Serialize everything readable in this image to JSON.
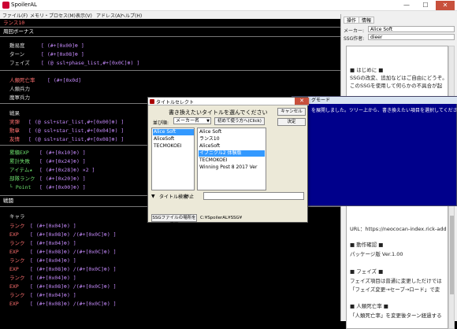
{
  "window": {
    "title": "SpoilerAL",
    "close": "✕",
    "minimize": "—",
    "maximize": "☐"
  },
  "menu": [
    "ファイル(F)",
    "メモリ・プロセス(M)",
    "表示(V)",
    "アドレス(A)",
    "ヘルプ(H)"
  ],
  "left": {
    "title": "ランス10",
    "rows": [
      {
        "kind": "head",
        "text": "周回ボーナス"
      },
      {
        "kind": "row",
        "label": "難易度",
        "code": "[ (#+[0x00]⊕ ]"
      },
      {
        "kind": "row",
        "label": "ターン",
        "code": "[ (#+[0x08]⊕ ]"
      },
      {
        "kind": "row",
        "label": "フェイズ",
        "code": "[ (@ ssl+phase_list,#+[0x0C]⊕) ]"
      },
      {
        "kind": "row",
        "label": "人類死亡率",
        "code": "[ (#+[0x0d]"
      },
      {
        "kind": "plain",
        "label": "人類兵力"
      },
      {
        "kind": "plain",
        "label": "魔軍兵力"
      },
      {
        "kind": "row",
        "label": "戦果",
        "code": ""
      },
      {
        "kind": "row",
        "label": "実弾",
        "code": "[ (@ ssl+star_list,#+[0x00]⊕) ]"
      },
      {
        "kind": "row",
        "label": "勲章",
        "code": "[ (@ ssl+star_list,#+[0x04]⊕) ]"
      },
      {
        "kind": "row",
        "label": "友情",
        "code": "[ (@ ssl+star_list,#+[0x08]⊕) ]"
      },
      {
        "kind": "row",
        "label": "累積EXP",
        "code": "[ (#+[0x10]⊕) ]"
      },
      {
        "kind": "row",
        "label": "累計失敗",
        "code": "[ (#+[0x24]⊕) ]"
      },
      {
        "kind": "row",
        "label": "アイテム★",
        "code": "[ (#+[0x28]⊕) ×2 ]"
      },
      {
        "kind": "row",
        "label": "部隊ランク",
        "code": "[ (#+[0x20]⊕) ]"
      },
      {
        "kind": "row",
        "label": "└ Point",
        "code": "[ (#+[0x00]⊕) ]"
      },
      {
        "kind": "head",
        "text": "戦闘"
      },
      {
        "kind": "plain",
        "label": "キャラ"
      },
      {
        "kind": "row",
        "label": "ランク",
        "code": "[ (#+[0x04]⊕) ]"
      },
      {
        "kind": "row",
        "label": "EXP",
        "code": "[ (#+[0x08]⊕) /(#+[0x0C]⊕) ]"
      },
      {
        "kind": "row",
        "label": "ランク",
        "code": "[ (#+[0x04]⊕) ]"
      },
      {
        "kind": "row",
        "label": "EXP",
        "code": "[ (#+[0x08]⊕) /(#+[0x0C]⊕) ]"
      },
      {
        "kind": "row",
        "label": "ランク",
        "code": "[ (#+[0x04]⊕) ]"
      },
      {
        "kind": "row",
        "label": "EXP",
        "code": "[ (#+[0x08]⊕) /(#+[0x0C]⊕) ]"
      },
      {
        "kind": "row",
        "label": "ランク",
        "code": "[ (#+[0x04]⊕) ]"
      },
      {
        "kind": "row",
        "label": "EXP",
        "code": "[ (#+[0x08]⊕) /(#+[0x0C]⊕) ]"
      },
      {
        "kind": "row",
        "label": "ランク",
        "code": "[ (#+[0x04]⊕) ]"
      },
      {
        "kind": "row",
        "label": "EXP",
        "code": "[ (#+[0x08]⊕) /(#+[0x0C]⊕) ]"
      }
    ]
  },
  "right": {
    "tabs": [
      "操作",
      "情報"
    ],
    "maker_label": "メーカー:",
    "maker_value": "Alice Soft",
    "author_label": "SSG作者:",
    "author_value": "dieer",
    "notes": [
      "■ はじめに ■",
      "SSGの改変、追加などはご自由にどうぞ。",
      "このSSGを使用して何らかの不具合が起",
      "",
      "",
      "",
      "",
      "",
      "",
      "",
      "",
      "",
      "",
      "",
      "",
      "",
      "",
      "",
      "",
      "",
      "URL：https://neococan-index.rick-add",
      "",
      "■ 動作確認 ■",
      "パッケージ版 Ver.1.00",
      "",
      "■ フェイズ ■",
      "フェイズ項目は普通に変更しただけでは",
      "「フェイズ変更→セーブ→ロード」で変",
      "",
      "■ 人類死亡率 ■",
      "「人類死亡率」を変更後ターン経過する"
    ]
  },
  "bluewin": {
    "title": "グモード",
    "text": "を展開しました。ツリー上から、書き換えたい項目を選択してください。"
  },
  "dialog": {
    "title": "タイトルセレクト",
    "prompt": "書き換えたいタイトルを選んでください",
    "cancel": "キャンセル",
    "ok": "決定",
    "sort_label": "並び順:",
    "sort_value": "メーカー名",
    "sort_arrow": "▼",
    "reload": "初めて使う方へ(Click)",
    "makers": [
      "Alice Soft",
      "AliceSoft",
      "TECMOKOEI"
    ],
    "titles": [
      "Alice Soft",
      "  ランス10",
      "AliceSoft",
      "  イブニクル2 体験版",
      "TECMOKOEI",
      "  Winning Post 8 2017 Ver"
    ],
    "search_arrow": "▼",
    "search_label": "タイトル検索",
    "stop_label": "停止",
    "path_btn": "SSGファイルの場所を変更",
    "path_value": "C:¥SpoilerAL¥SSG¥"
  }
}
